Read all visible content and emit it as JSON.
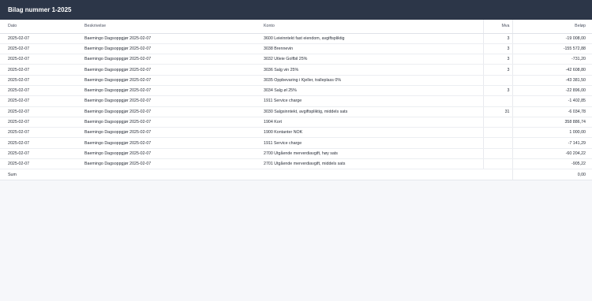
{
  "page": {
    "title": "Bilag nummer 1-2025"
  },
  "table": {
    "headers": {
      "date": "Dato",
      "description": "Beskrivelse",
      "account": "Konto",
      "mva": "Mva",
      "amount": "Beløp"
    },
    "rows": [
      {
        "date": "2025-02-07",
        "description": "Baemingo Dagsoppgjør 2025-02-07",
        "account": "3600 Leieinntekt fast eiendom, avgiftspliktig",
        "mva": "3",
        "amount": "-19 008,00"
      },
      {
        "date": "2025-02-07",
        "description": "Baemingo Dagsoppgjør 2025-02-07",
        "account": "3038 Brennevin",
        "mva": "3",
        "amount": "-155 572,88"
      },
      {
        "date": "2025-02-07",
        "description": "Baemingo Dagsoppgjør 2025-02-07",
        "account": "3032 Utleie Golfbil 25%",
        "mva": "3",
        "amount": "-731,20"
      },
      {
        "date": "2025-02-07",
        "description": "Baemingo Dagsoppgjør 2025-02-07",
        "account": "3036 Salg vin 25%",
        "mva": "3",
        "amount": "-42 608,80"
      },
      {
        "date": "2025-02-07",
        "description": "Baemingo Dagsoppgjør 2025-02-07",
        "account": "3035 Oppbevaring i Kjeller, tralleplass 0%",
        "mva": "",
        "amount": "-43 381,50"
      },
      {
        "date": "2025-02-07",
        "description": "Baemingo Dagsoppgjør 2025-02-07",
        "account": "3034 Salg øl 25%",
        "mva": "3",
        "amount": "-22 896,00"
      },
      {
        "date": "2025-02-07",
        "description": "Baemingo Dagsoppgjør 2025-02-07",
        "account": "1911 Service charge",
        "mva": "",
        "amount": "-1 402,85"
      },
      {
        "date": "2025-02-07",
        "description": "Baemingo Dagsoppgjør 2025-02-07",
        "account": "3030 Salgsinntekt, avgiftspliktig, middels sats",
        "mva": "31",
        "amount": "-6 034,78"
      },
      {
        "date": "2025-02-07",
        "description": "Baemingo Dagsoppgjør 2025-02-07",
        "account": "1904 Kort",
        "mva": "",
        "amount": "358 886,74"
      },
      {
        "date": "2025-02-07",
        "description": "Baemingo Dagsoppgjør 2025-02-07",
        "account": "1900 Kontanter NOK",
        "mva": "",
        "amount": "1 000,00"
      },
      {
        "date": "2025-02-07",
        "description": "Baemingo Dagsoppgjør 2025-02-07",
        "account": "1911 Service charge",
        "mva": "",
        "amount": "-7 141,29"
      },
      {
        "date": "2025-02-07",
        "description": "Baemingo Dagsoppgjør 2025-02-07",
        "account": "2700 Utgående merverdiavgift, høy sats",
        "mva": "",
        "amount": "-60 204,22"
      },
      {
        "date": "2025-02-07",
        "description": "Baemingo Dagsoppgjør 2025-02-07",
        "account": "2701 Utgående merverdiavgift, middels sats",
        "mva": "",
        "amount": "-905,22"
      }
    ],
    "sum": {
      "label": "Sum",
      "amount": "0,00"
    }
  }
}
